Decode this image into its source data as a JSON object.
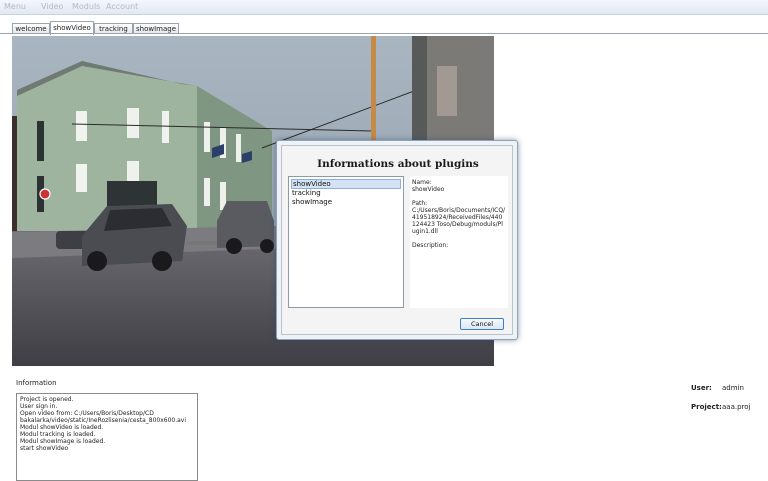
{
  "menu": {
    "items": [
      "Menu",
      "Video",
      "Moduls",
      "Account"
    ]
  },
  "tabs": [
    {
      "label": "welcome"
    },
    {
      "label": "showVideo",
      "active": true
    },
    {
      "label": "tracking"
    },
    {
      "label": "showImage"
    }
  ],
  "dialog": {
    "title": "Informations about plugins",
    "plugins": [
      "showVideo",
      "tracking",
      "showImage"
    ],
    "selected_index": 0,
    "details": {
      "name_label": "Name:",
      "name_value": "showVideo",
      "path_label": "Path:",
      "path_value": "C:/Users/Boris/Documents/ICQ/419518924/ReceivedFiles/440124423 Toso/Debug/moduls/Plugin1.dll",
      "description_label": "Description:"
    },
    "cancel_label": "Cancel"
  },
  "info": {
    "label": "Information",
    "log": [
      "Project is opened.",
      "User sign in.",
      "Open video from: C:/Users/Boris/Desktop/CD",
      "bakalarka/video/static/IneRozlisenia/cesta_800x600.avi",
      "Modul showVideo is loaded.",
      "Modul tracking is loaded.",
      "Modul showImage is loaded.",
      "start showVideo"
    ]
  },
  "status": {
    "user_label": "User:",
    "user_value": "admin",
    "project_label": "Project:",
    "project_value": "aaa.proj"
  },
  "colors": {
    "selection": "#d3e3f5",
    "accent": "#3f7fc6"
  }
}
